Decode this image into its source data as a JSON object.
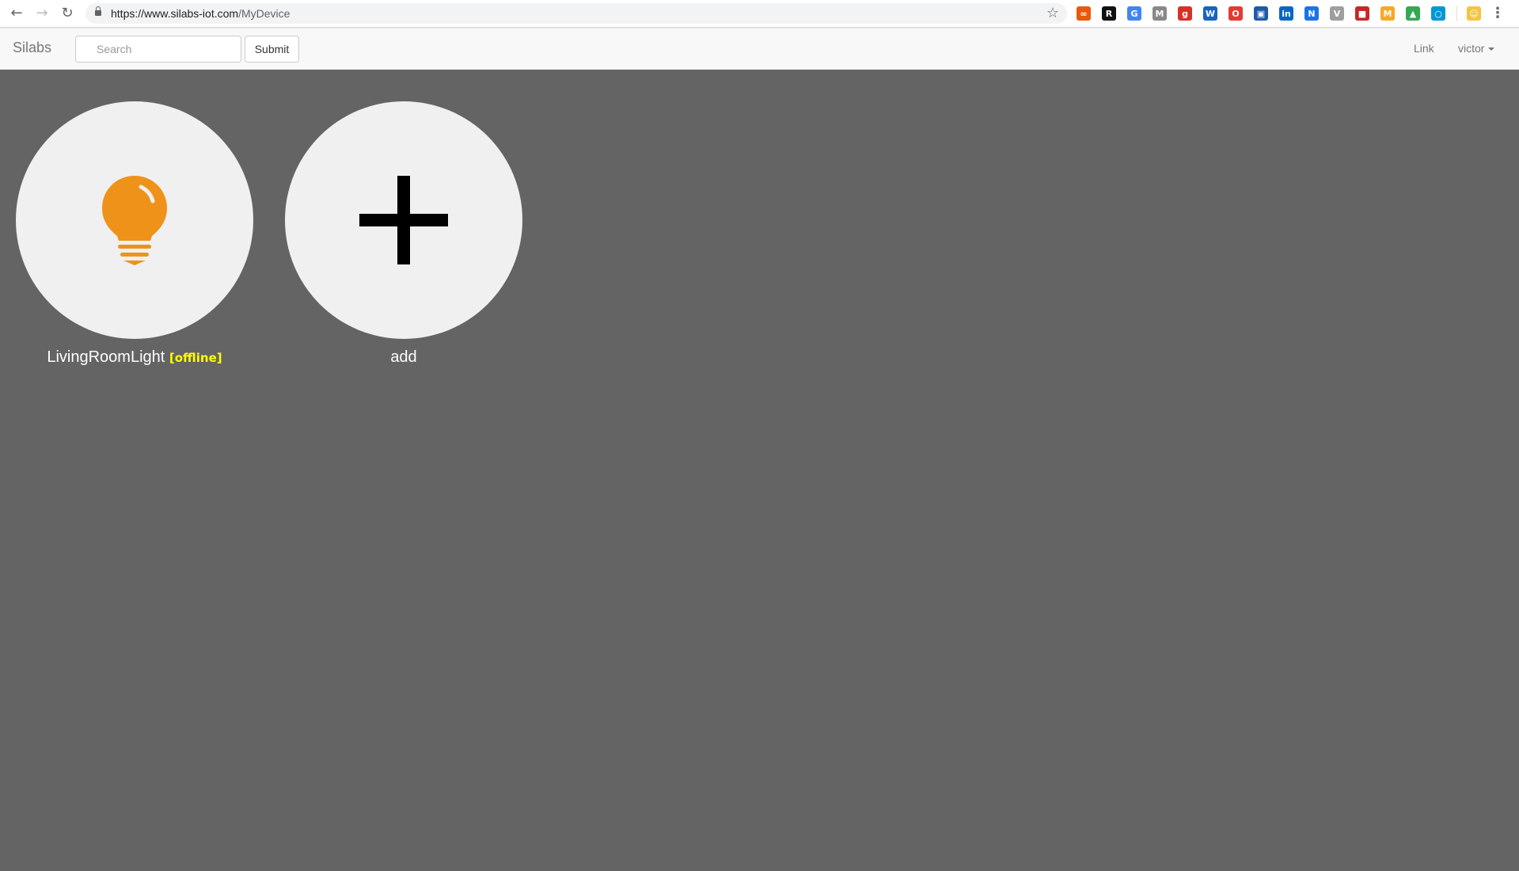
{
  "browser": {
    "url_host": "https://www.silabs-iot.com",
    "url_path": "/MyDevice",
    "back_glyph": "←",
    "forward_glyph": "→",
    "reload_glyph": "↻",
    "star_glyph": "☆",
    "menu_glyph": "⋮",
    "extensions": [
      {
        "name": "ext-orange-icon",
        "glyph": "∞",
        "color": "#e8590c"
      },
      {
        "name": "ext-r-icon",
        "glyph": "R",
        "color": "#111111"
      },
      {
        "name": "ext-translate-icon",
        "glyph": "G",
        "color": "#4285f4"
      },
      {
        "name": "ext-gmail-icon",
        "glyph": "M",
        "color": "#888888"
      },
      {
        "name": "ext-red-icon",
        "glyph": "g",
        "color": "#d93025"
      },
      {
        "name": "ext-w-icon",
        "glyph": "W",
        "color": "#1565c0"
      },
      {
        "name": "ext-opera-icon",
        "glyph": "O",
        "color": "#e53935"
      },
      {
        "name": "ext-blue-icon",
        "glyph": "▣",
        "color": "#1e5aa8"
      },
      {
        "name": "ext-linkedin-icon",
        "glyph": "in",
        "color": "#0a66c2"
      },
      {
        "name": "ext-new-icon",
        "glyph": "N",
        "color": "#1a73e8"
      },
      {
        "name": "ext-v-icon",
        "glyph": "V",
        "color": "#9e9e9e"
      },
      {
        "name": "ext-bookmark-icon",
        "glyph": "■",
        "color": "#c62828"
      },
      {
        "name": "ext-m-icon",
        "glyph": "M",
        "color": "#f9a825"
      },
      {
        "name": "ext-drive-icon",
        "glyph": "▲",
        "color": "#34a853"
      },
      {
        "name": "ext-circle-icon",
        "glyph": "○",
        "color": "#0097d7"
      },
      {
        "name": "ext-emoji-icon",
        "glyph": "☺",
        "color": "#f6c343"
      }
    ]
  },
  "navbar": {
    "brand": "Silabs",
    "search_placeholder": "Search",
    "submit_label": "Submit",
    "link_label": "Link",
    "user_label": "victor"
  },
  "devices": [
    {
      "name": "LivingRoomLight",
      "status": "[offline]",
      "icon": "lightbulb-icon",
      "icon_color": "#ef921a"
    },
    {
      "name": "add",
      "icon": "plus-icon",
      "icon_color": "#000000"
    }
  ]
}
